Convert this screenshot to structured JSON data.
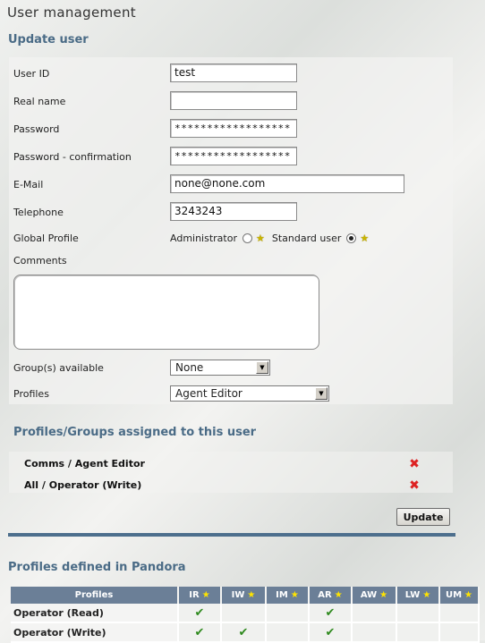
{
  "page": {
    "title": "User management",
    "subtitle": "Update user"
  },
  "form": {
    "user_id_label": "User ID",
    "user_id_value": "test",
    "real_name_label": "Real name",
    "real_name_value": "",
    "password_label": "Password",
    "password_value": "******************",
    "password_confirm_label": "Password - confirmation",
    "password_confirm_value": "******************",
    "email_label": "E-Mail",
    "email_value": "none@none.com",
    "telephone_label": "Telephone",
    "telephone_value": "3243243",
    "global_profile_label": "Global Profile",
    "global_profile_options": [
      {
        "label": "Administrator",
        "selected": false
      },
      {
        "label": "Standard user",
        "selected": true
      }
    ],
    "comments_label": "Comments",
    "comments_value": "",
    "groups_label": "Group(s) available",
    "groups_selected": "None",
    "profiles_label": "Profiles",
    "profiles_selected": "Agent Editor"
  },
  "assigned": {
    "heading": "Profiles/Groups assigned to this user",
    "items": [
      {
        "label": "Comms / Agent Editor"
      },
      {
        "label": "All / Operator (Write)"
      }
    ]
  },
  "update_button": "Update",
  "profiles_defined": {
    "heading": "Profiles defined in Pandora",
    "columns": [
      "Profiles",
      "IR",
      "IW",
      "IM",
      "AR",
      "AW",
      "LW",
      "UM"
    ],
    "rows": [
      {
        "name": "Operator (Read)",
        "checks": [
          true,
          false,
          false,
          true,
          false,
          false,
          false
        ]
      },
      {
        "name": "Operator (Write)",
        "checks": [
          true,
          true,
          false,
          true,
          false,
          false,
          false
        ]
      }
    ]
  },
  "icons": {
    "star": "star-icon",
    "delete": "delete-x-icon",
    "check": "check-icon",
    "dropdown": "chevron-down-icon"
  },
  "colors": {
    "heading_blue": "#4a6b86",
    "table_header": "#6b7f97",
    "divider": "#4d6f8d",
    "delete_red": "#dd2222",
    "check_green": "#2f8a1e"
  }
}
